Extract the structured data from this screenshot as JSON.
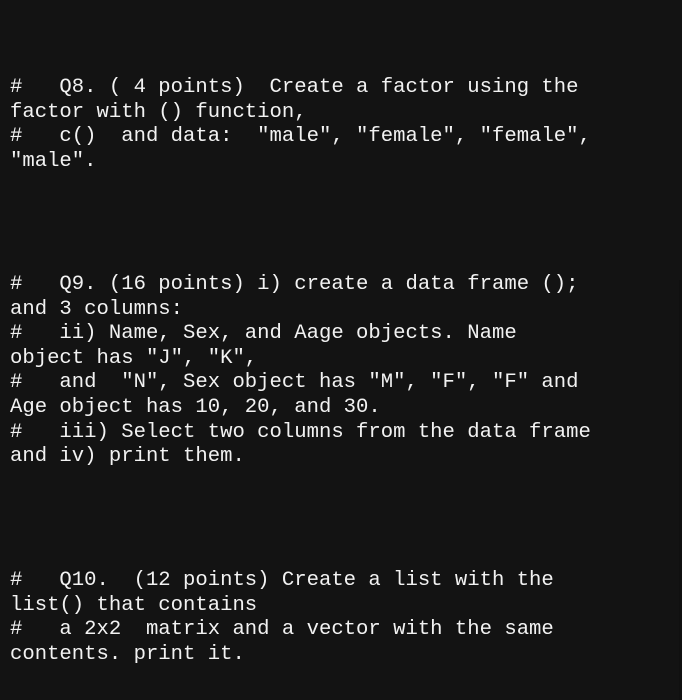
{
  "comments": [
    {
      "id": "Q8",
      "lines": [
        "#   Q8. ( 4 points)  Create a factor using the",
        "factor with () function,",
        "#   c()  and data:  \"male\", \"female\", \"female\",",
        "\"male\"."
      ]
    },
    {
      "id": "Q9",
      "lines": [
        "#   Q9. (16 points) i) create a data frame ();",
        "and 3 columns:",
        "#   ii) Name, Sex, and Aage objects. Name",
        "object has \"J\", \"K\",",
        "#   and  \"N\", Sex object has \"M\", \"F\", \"F\" and",
        "Age object has 10, 20, and 30.",
        "#   iii) Select two columns from the data frame",
        "and iv) print them."
      ]
    },
    {
      "id": "Q10",
      "lines": [
        "#   Q10.  (12 points) Create a list with the",
        "list() that contains",
        "#   a 2x2  matrix and a vector with the same",
        "contents. print it."
      ]
    }
  ]
}
